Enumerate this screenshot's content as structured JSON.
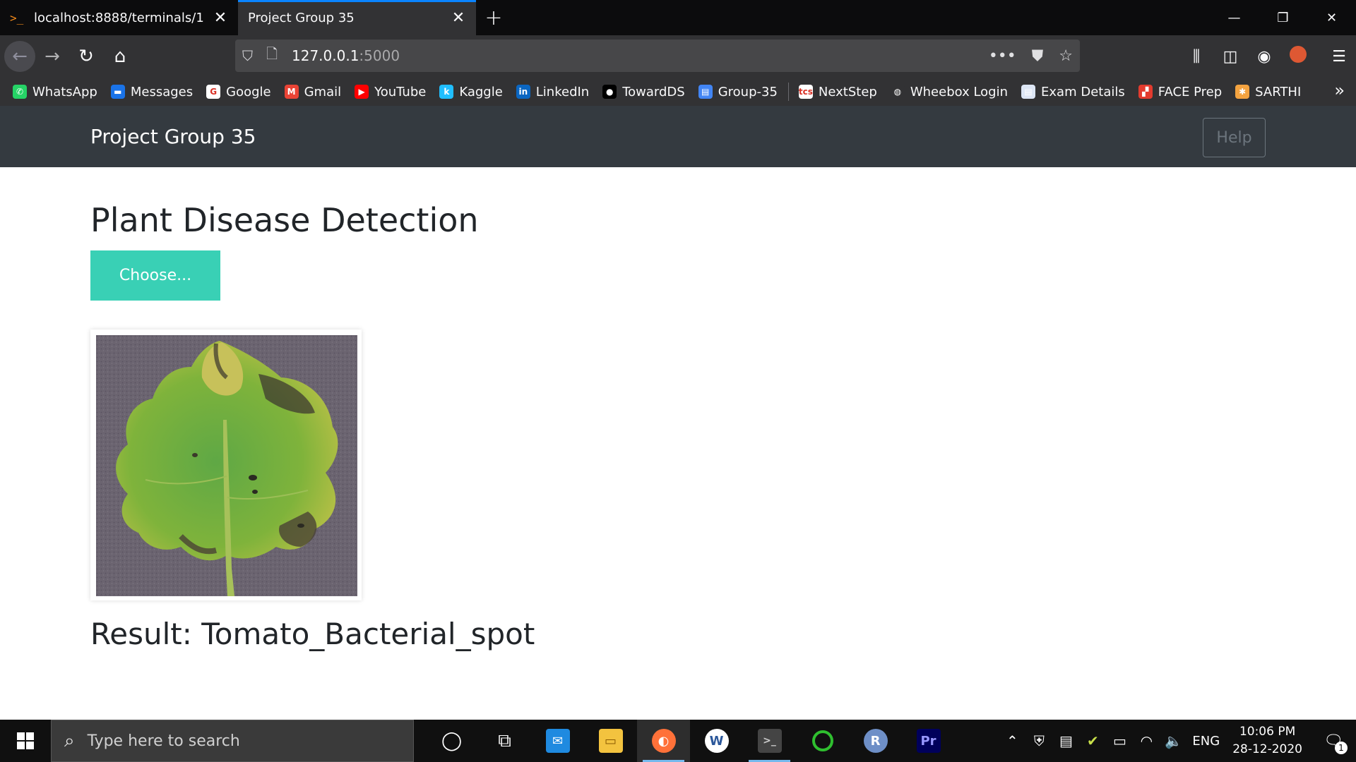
{
  "browser": {
    "tabs": [
      {
        "title": "localhost:8888/terminals/1",
        "icon": "terminal-icon",
        "active": false
      },
      {
        "title": "Project Group 35",
        "icon": "",
        "active": true
      }
    ],
    "url_host": "127.0.0.1",
    "url_port": ":5000",
    "bookmarks": [
      {
        "label": "WhatsApp",
        "icon": "whatsapp-icon",
        "color": "#25d366",
        "glyph": "✆"
      },
      {
        "label": "Messages",
        "icon": "messages-icon",
        "color": "#1a73e8",
        "glyph": "▬"
      },
      {
        "label": "Google",
        "icon": "google-icon",
        "color": "#ffffff",
        "glyph": "G"
      },
      {
        "label": "Gmail",
        "icon": "gmail-icon",
        "color": "#ea4335",
        "glyph": "M"
      },
      {
        "label": "YouTube",
        "icon": "youtube-icon",
        "color": "#ff0000",
        "glyph": "▶"
      },
      {
        "label": "Kaggle",
        "icon": "kaggle-icon",
        "color": "#20beff",
        "glyph": "k"
      },
      {
        "label": "LinkedIn",
        "icon": "linkedin-icon",
        "color": "#0a66c2",
        "glyph": "in"
      },
      {
        "label": "TowardDS",
        "icon": "medium-icon",
        "color": "#000000",
        "glyph": "●"
      },
      {
        "label": "Group-35",
        "icon": "google-meet-icon",
        "color": "#4285f4",
        "glyph": "▤"
      },
      {
        "label": "NextStep",
        "icon": "tcs-icon",
        "color": "#ffffff",
        "glyph": "tcs"
      },
      {
        "label": "Wheebox Login",
        "icon": "globe-icon",
        "color": "#323234",
        "glyph": "◍"
      },
      {
        "label": "Exam Details",
        "icon": "document-icon",
        "color": "#dde6f5",
        "glyph": "▤"
      },
      {
        "label": "FACE Prep",
        "icon": "face-prep-icon",
        "color": "#e33b2e",
        "glyph": "▞"
      },
      {
        "label": "SARTHI",
        "icon": "sarthi-icon",
        "color": "#f4a340",
        "glyph": "✱"
      }
    ]
  },
  "app": {
    "brand": "Project Group 35",
    "help_label": "Help",
    "title": "Plant Disease Detection",
    "choose_label": "Choose...",
    "result_text": "Result: Tomato_Bacterial_spot",
    "accent_color": "#39d0b5",
    "navbar_color": "#343a40"
  },
  "taskbar": {
    "search_placeholder": "Type here to search",
    "language": "ENG",
    "time": "10:06 PM",
    "date": "28-12-2020",
    "notification_count": "1"
  }
}
